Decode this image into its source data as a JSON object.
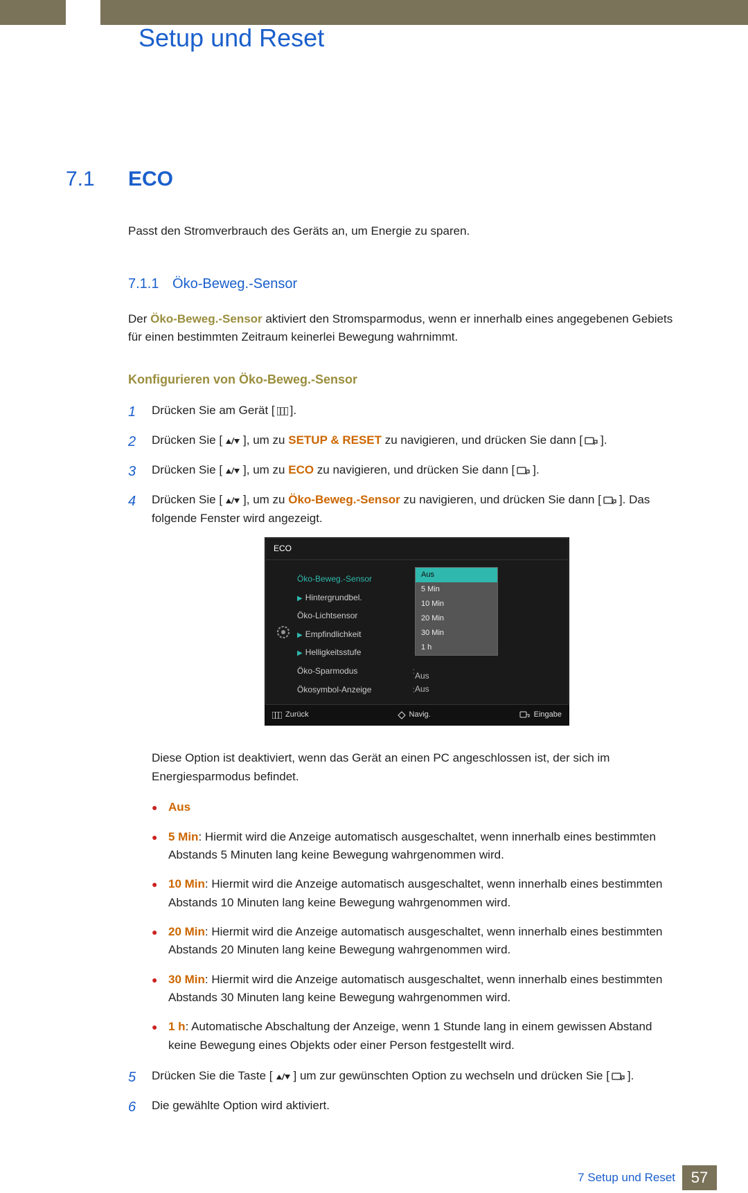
{
  "chapter_title": "Setup und Reset",
  "section": {
    "num": "7.1",
    "title": "ECO"
  },
  "intro": "Passt den Stromverbrauch des Geräts an, um Energie zu sparen.",
  "sub": {
    "num": "7.1.1",
    "title": "Öko-Beweg.-Sensor"
  },
  "sensor_para_pre": "Der ",
  "sensor_para_bold": "Öko-Beweg.-Sensor",
  "sensor_para_post": " aktiviert den Stromsparmodus, wenn er innerhalb eines angegebenen Gebiets für einen bestimmten Zeitraum keinerlei Bewegung wahrnimmt.",
  "konf_heading": "Konfigurieren von Öko-Beweg.-Sensor",
  "step1": {
    "pre": "Drücken Sie am Gerät [",
    "post": "]."
  },
  "step2": {
    "pre": "Drücken Sie [",
    "mid": "], um zu ",
    "target": "SETUP & RESET",
    "after": " zu navigieren, und drücken Sie dann [",
    "end": "]."
  },
  "step3": {
    "pre": "Drücken Sie [",
    "mid": "], um zu ",
    "target": "ECO",
    "after": " zu navigieren, und drücken Sie dann [",
    "end": "]."
  },
  "step4": {
    "pre": "Drücken Sie [",
    "mid": "], um zu ",
    "target": "Öko-Beweg.-Sensor",
    "after": " zu navigieren, und drücken Sie dann [",
    "tail": "]. Das folgende Fenster wird angezeigt."
  },
  "osd": {
    "title": "ECO",
    "items": [
      "Öko-Beweg.-Sensor",
      "Hintergrundbel.",
      "Öko-Lichtsensor",
      "Empfindlichkeit",
      "Helligkeitsstufe",
      "Öko-Sparmodus",
      "Ökosymbol-Anzeige"
    ],
    "options": [
      "Aus",
      "5 Min",
      "10 Min",
      "20 Min",
      "30 Min",
      "1 h"
    ],
    "val_spar": "Aus",
    "val_oko": "Aus",
    "footer": {
      "back": "Zurück",
      "nav": "Navig.",
      "enter": "Eingabe"
    }
  },
  "note": "Diese Option ist deaktiviert, wenn das Gerät an einen PC angeschlossen ist, der sich im Energiesparmodus befindet.",
  "bullets": {
    "aus": "Aus",
    "b5_head": "5 Min",
    "b5": ": Hiermit wird die Anzeige automatisch ausgeschaltet, wenn innerhalb eines bestimmten Abstands 5 Minuten lang keine Bewegung wahrgenommen wird.",
    "b10_head": "10 Min",
    "b10": ": Hiermit wird die Anzeige automatisch ausgeschaltet, wenn innerhalb eines bestimmten Abstands 10 Minuten lang keine Bewegung wahrgenommen wird.",
    "b20_head": "20 Min",
    "b20": ": Hiermit wird die Anzeige automatisch ausgeschaltet, wenn innerhalb eines bestimmten Abstands 20 Minuten lang keine Bewegung wahrgenommen wird.",
    "b30_head": "30 Min",
    "b30": ": Hiermit wird die Anzeige automatisch ausgeschaltet, wenn innerhalb eines bestimmten Abstands 30 Minuten lang keine Bewegung wahrgenommen wird.",
    "b1h_head": "1 h",
    "b1h": ": Automatische Abschaltung der Anzeige, wenn 1 Stunde lang in einem gewissen Abstand keine Bewegung eines Objekts oder einer Person festgestellt wird."
  },
  "step5": {
    "pre": "Drücken Sie die Taste [",
    "mid": "] um zur gewünschten Option zu wechseln und drücken Sie [",
    "end": "]."
  },
  "step6": "Die gewählte Option wird aktiviert.",
  "footer": {
    "label": "7 Setup und Reset",
    "page": "57"
  }
}
